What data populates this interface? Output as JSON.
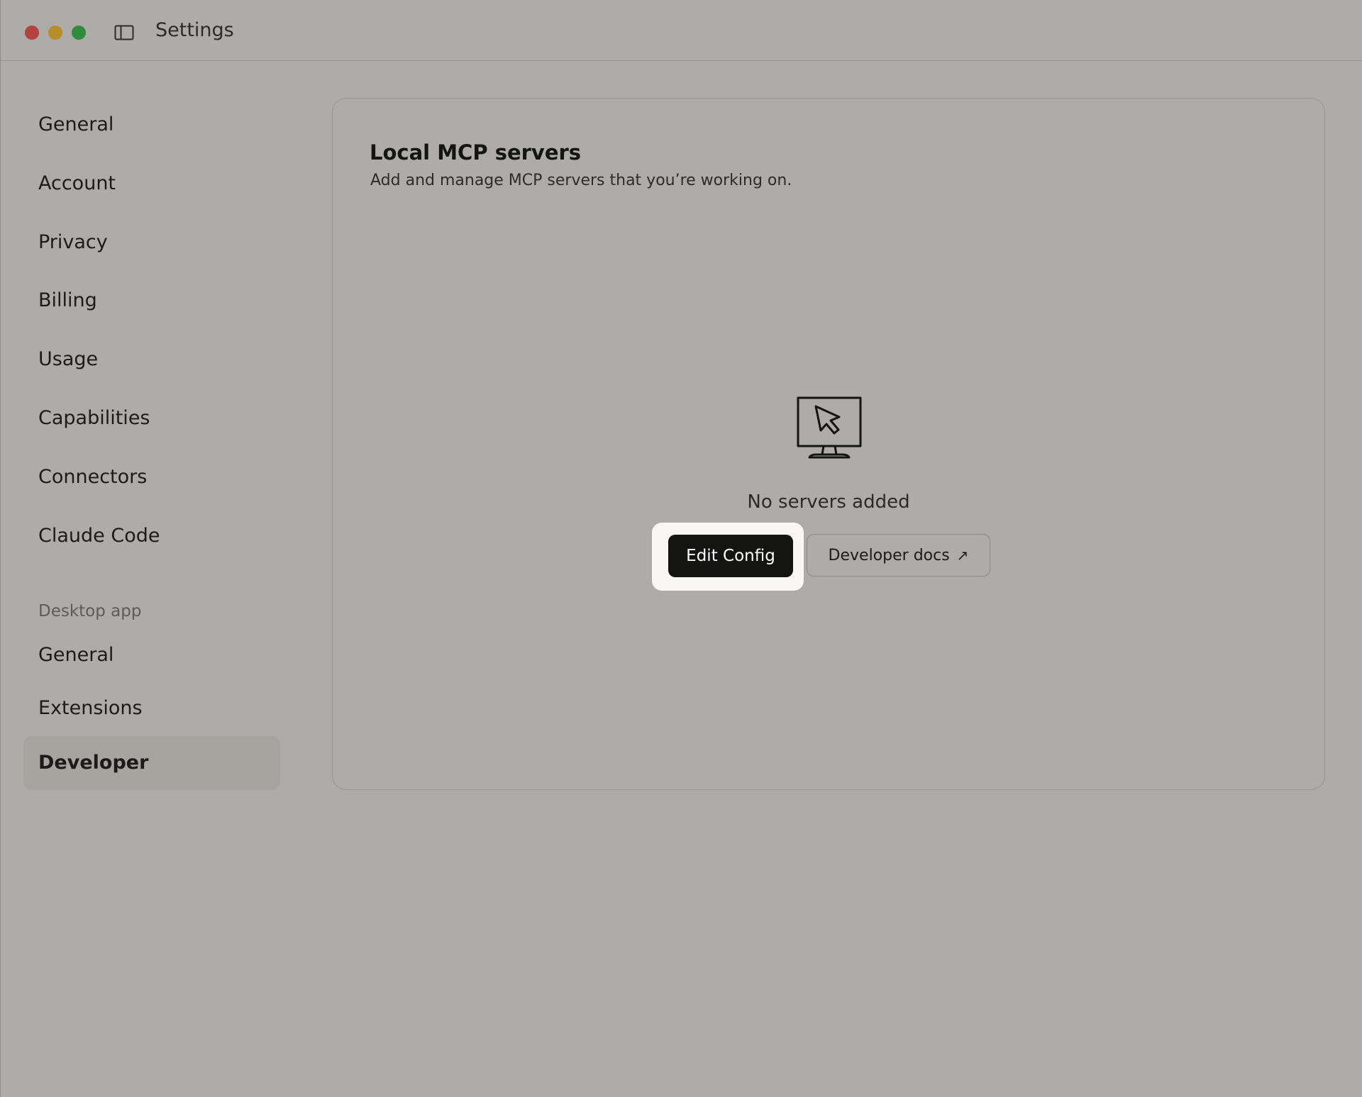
{
  "window": {
    "title": "Settings"
  },
  "sidebar": {
    "items": [
      {
        "label": "General"
      },
      {
        "label": "Account"
      },
      {
        "label": "Privacy"
      },
      {
        "label": "Billing"
      },
      {
        "label": "Usage"
      },
      {
        "label": "Capabilities"
      },
      {
        "label": "Connectors"
      },
      {
        "label": "Claude Code"
      }
    ],
    "desktop_section": {
      "heading": "Desktop app",
      "items": [
        {
          "label": "General"
        },
        {
          "label": "Extensions"
        },
        {
          "label": "Developer",
          "active": true
        }
      ]
    }
  },
  "main": {
    "title": "Local MCP servers",
    "subtitle": "Add and manage MCP servers that you’re working on.",
    "empty_icon": "monitor-cursor-icon",
    "empty_text": "No servers added",
    "edit_config_label": "Edit Config",
    "developer_docs_label": "Developer docs",
    "external_link_icon": "arrow-up-right-icon"
  }
}
